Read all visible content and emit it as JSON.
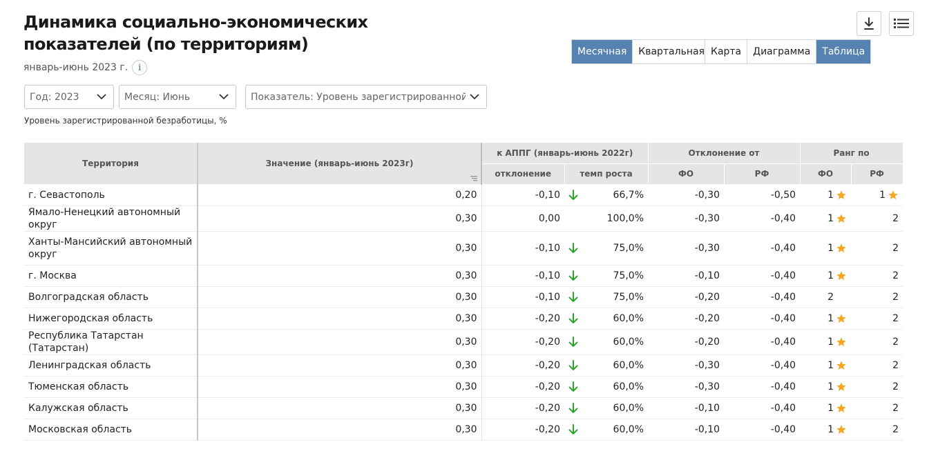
{
  "page": {
    "title": "Динамика социально-экономических показателей (по территориям)",
    "subtitle": "январь-июнь 2023 г.",
    "info_icon": "i"
  },
  "toolbar": {
    "download_icon": "download-icon",
    "list_icon": "list-icon"
  },
  "period_tabs": [
    {
      "label": "Месячная",
      "active": true
    },
    {
      "label": "Квартальная",
      "active": false
    }
  ],
  "view_tabs": [
    {
      "label": "Карта",
      "active": false
    },
    {
      "label": "Диаграмма",
      "active": false
    },
    {
      "label": "Таблица",
      "active": true
    }
  ],
  "filters": {
    "year": "Год: 2023",
    "month": "Месяц: Июнь",
    "indicator": "Показатель: Уровень зарегистрированной безработицы"
  },
  "caption": "Уровень зарегистрированной безработицы, %",
  "colors": {
    "accent": "#5582b0",
    "arrow_down": "#2aa82a",
    "star": "#f5a623",
    "header_bg": "#e5e5e5"
  },
  "table": {
    "headers": {
      "territory": "Территория",
      "value": "Значение (январь-июнь 2023г)",
      "appg": "к АППГ (январь-июнь 2022г)",
      "deviation_from": "Отклонение от",
      "rank_by": "Ранг по",
      "appg_dev": "отклонение",
      "appg_rate": "темп роста",
      "fo": "ФО",
      "rf": "РФ",
      "rank_fo": "ФО",
      "rank_rf": "РФ"
    },
    "rows": [
      {
        "territory": "г. Севастополь",
        "value": "0,20",
        "dev": "-0,10",
        "down": true,
        "rate": "66,7%",
        "fo": "-0,30",
        "rf": "-0,50",
        "rank_fo": "1",
        "star_fo": true,
        "rank_rf": "1",
        "star_rf": true
      },
      {
        "territory": "Ямало-Ненецкий автономный округ",
        "value": "0,30",
        "dev": "0,00",
        "down": false,
        "rate": "100,0%",
        "fo": "-0,30",
        "rf": "-0,40",
        "rank_fo": "1",
        "star_fo": true,
        "rank_rf": "2",
        "star_rf": false
      },
      {
        "territory": "Ханты-Мансийский автономный округ",
        "value": "0,30",
        "dev": "-0,10",
        "down": true,
        "rate": "75,0%",
        "fo": "-0,30",
        "rf": "-0,40",
        "rank_fo": "1",
        "star_fo": true,
        "rank_rf": "2",
        "star_rf": false
      },
      {
        "territory": "г. Москва",
        "value": "0,30",
        "dev": "-0,10",
        "down": true,
        "rate": "75,0%",
        "fo": "-0,10",
        "rf": "-0,40",
        "rank_fo": "1",
        "star_fo": true,
        "rank_rf": "2",
        "star_rf": false
      },
      {
        "territory": "Волгоградская область",
        "value": "0,30",
        "dev": "-0,10",
        "down": true,
        "rate": "75,0%",
        "fo": "-0,20",
        "rf": "-0,40",
        "rank_fo": "2",
        "star_fo": false,
        "rank_rf": "2",
        "star_rf": false
      },
      {
        "territory": "Нижегородская область",
        "value": "0,30",
        "dev": "-0,20",
        "down": true,
        "rate": "60,0%",
        "fo": "-0,20",
        "rf": "-0,40",
        "rank_fo": "1",
        "star_fo": true,
        "rank_rf": "2",
        "star_rf": false
      },
      {
        "territory": "Республика Татарстан (Татарстан)",
        "value": "0,30",
        "dev": "-0,20",
        "down": true,
        "rate": "60,0%",
        "fo": "-0,20",
        "rf": "-0,40",
        "rank_fo": "1",
        "star_fo": true,
        "rank_rf": "2",
        "star_rf": false
      },
      {
        "territory": "Ленинградская область",
        "value": "0,30",
        "dev": "-0,20",
        "down": true,
        "rate": "60,0%",
        "fo": "-0,30",
        "rf": "-0,40",
        "rank_fo": "1",
        "star_fo": true,
        "rank_rf": "2",
        "star_rf": false
      },
      {
        "territory": "Тюменская область",
        "value": "0,30",
        "dev": "-0,20",
        "down": true,
        "rate": "60,0%",
        "fo": "-0,30",
        "rf": "-0,40",
        "rank_fo": "1",
        "star_fo": true,
        "rank_rf": "2",
        "star_rf": false
      },
      {
        "territory": "Калужская область",
        "value": "0,30",
        "dev": "-0,20",
        "down": true,
        "rate": "60,0%",
        "fo": "-0,10",
        "rf": "-0,40",
        "rank_fo": "1",
        "star_fo": true,
        "rank_rf": "2",
        "star_rf": false
      },
      {
        "territory": "Московская область",
        "value": "0,30",
        "dev": "-0,20",
        "down": true,
        "rate": "60,0%",
        "fo": "-0,10",
        "rf": "-0,40",
        "rank_fo": "1",
        "star_fo": true,
        "rank_rf": "2",
        "star_rf": false
      }
    ]
  }
}
